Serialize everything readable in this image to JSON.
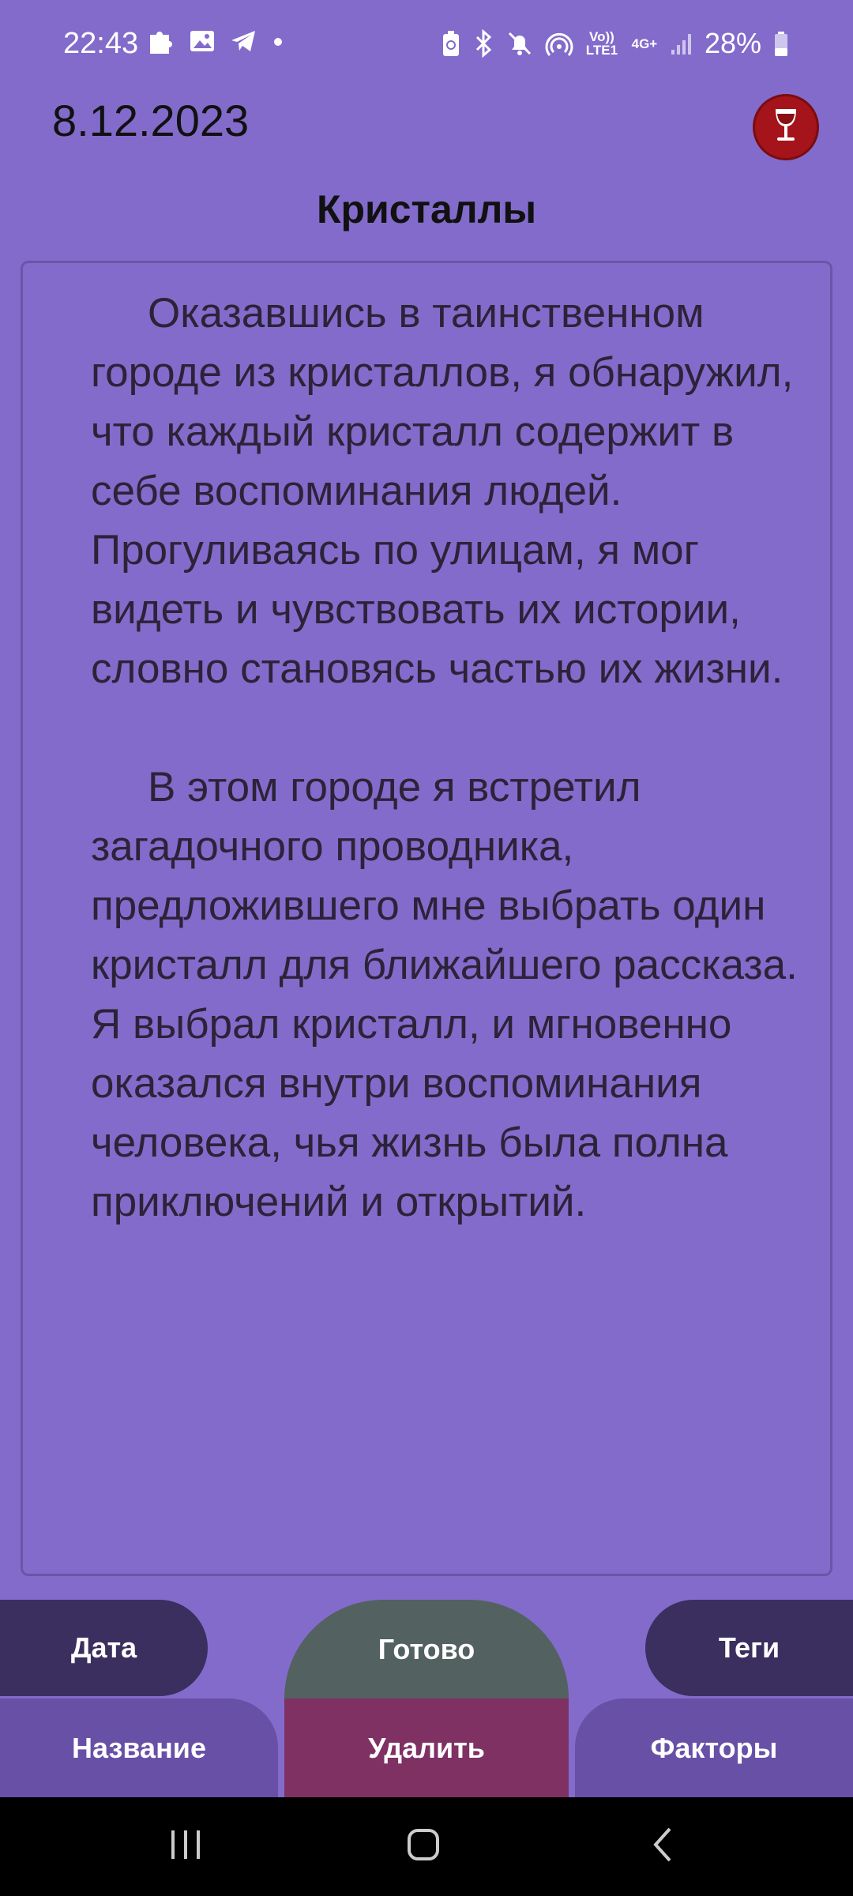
{
  "status": {
    "time": "22:43",
    "battery": "28%",
    "volte": "Vo)) LTE1",
    "network": "4G+"
  },
  "icons": {
    "notif": [
      "puzzle-icon",
      "image-icon",
      "telegram-icon",
      "dot-icon"
    ],
    "system": [
      "battery-saver-icon",
      "bluetooth-icon",
      "mute-icon",
      "hotspot-icon",
      "signal-icon",
      "battery-icon"
    ],
    "wine": "wine-glass-icon"
  },
  "header": {
    "date": "8.12.2023",
    "title": "Кристаллы"
  },
  "editor": {
    "paragraphs": [
      "Оказавшись в таинственном городе из кристаллов, я обнаружил, что каждый кристалл содержит в себе воспоминания людей. Прогуливаясь по улицам, я мог видеть и чувствовать их истории, словно становясь частью их жизни.",
      "В этом городе я встретил загадочного проводника, предложившего мне выбрать один кристалл для ближайшего рассказа. Я выбрал кристалл, и мгновенно оказался внутри воспоминания человека, чья жизнь была полна приключений и открытий."
    ]
  },
  "buttons": {
    "date": "Дата",
    "done": "Готово",
    "tags": "Теги",
    "name": "Название",
    "delete": "Удалить",
    "factors": "Факторы"
  },
  "colors": {
    "background": "#836bcb",
    "dark_button": "#3a2f5e",
    "done_button": "#536160",
    "delete_button": "#7f3163",
    "light_button": "#6750a6",
    "wine_badge": "#a5141a"
  }
}
